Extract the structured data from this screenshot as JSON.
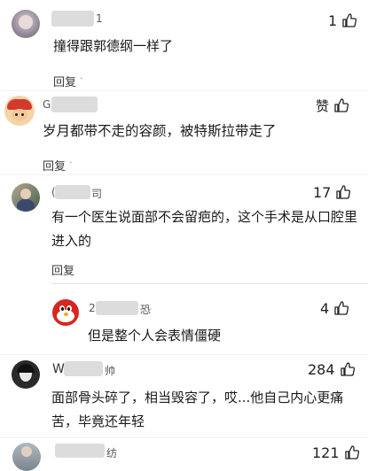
{
  "comments": [
    {
      "text_lines": [
        "撞得跟郭德纲一样了"
      ],
      "name_fragment": "1",
      "like_label": "1",
      "reply_label": "回复",
      "reply_suffix": "·"
    },
    {
      "text_lines": [
        "岁月都带不走的容颜，被特斯拉带走了"
      ],
      "name_fragment": "G",
      "like_label": "赞",
      "reply_label": "回复",
      "reply_suffix": "·"
    },
    {
      "text_lines": [
        "有一个医生说面部不会留疤的，这个手术是从口腔里",
        "进入的"
      ],
      "name_fragment": "(",
      "name_fragment_end": "司",
      "like_label": "17",
      "reply_label": "回复"
    },
    {
      "text_lines": [
        "但是整个人会表情僵硬"
      ],
      "name_fragment": "2",
      "name_fragment_end": "恐",
      "like_label": "4"
    },
    {
      "text_lines": [
        "面部骨头碎了，相当毁容了，哎...他自己内心更痛",
        "苦，毕竟还年轻"
      ],
      "name_fragment": "W",
      "name_fragment_end": "帅",
      "like_label": "284"
    },
    {
      "name_fragment": "纺",
      "like_label": "121"
    }
  ],
  "colors": {
    "divider": "#eeeeee",
    "nested_divider": "#e4e4e4",
    "text": "#1a1a1a",
    "blur": "#dcdcdc"
  }
}
